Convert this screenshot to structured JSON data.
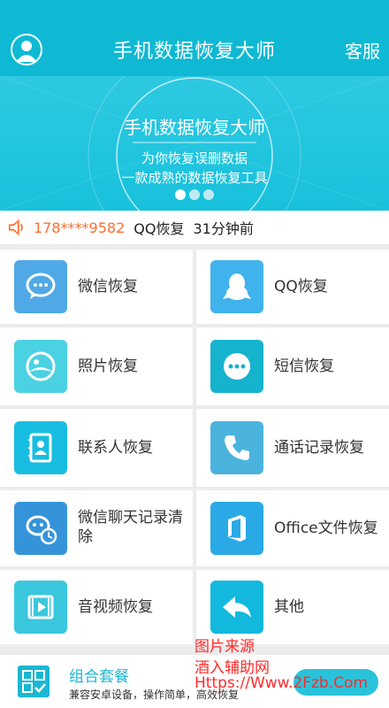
{
  "header": {
    "title": "手机数据恢复大师",
    "service": "客服"
  },
  "banner": {
    "title": "手机数据恢复大师",
    "line1": "为你恢复误删数据",
    "line2": "一款成熟的数据恢复工具"
  },
  "notice": {
    "phone": "178****9582",
    "service": "QQ恢复",
    "time": "31分钟前"
  },
  "grid": [
    {
      "label": "微信恢复",
      "icon": "wechat-icon",
      "color": "#4fa9e6"
    },
    {
      "label": "QQ恢复",
      "icon": "qq-penguin-icon",
      "color": "#40b3ec"
    },
    {
      "label": "照片恢复",
      "icon": "photo-icon",
      "color": "#4ad2e3"
    },
    {
      "label": "短信恢复",
      "icon": "sms-icon",
      "color": "#16b3ce"
    },
    {
      "label": "联系人恢复",
      "icon": "contacts-icon",
      "color": "#17bde0"
    },
    {
      "label": "通话记录恢复",
      "icon": "phone-icon",
      "color": "#4ab3dd"
    },
    {
      "label": "微信聊天记录清除",
      "icon": "wechat-clock-icon",
      "color": "#3594d9"
    },
    {
      "label": "Office文件恢复",
      "icon": "office-icon",
      "color": "#29a9e5"
    },
    {
      "label": "音视频恢复",
      "icon": "video-icon",
      "color": "#3ac7de"
    },
    {
      "label": "其他",
      "icon": "reply-arrow-icon",
      "color": "#12b9dd"
    }
  ],
  "bottom": {
    "title": "组合套餐",
    "desc": "兼容安卓设备，操作简单，高效恢复",
    "button": ""
  },
  "watermark": {
    "line1": "图片来源",
    "line2": "酒入辅助网",
    "line3": "Https://Www.2Fzb.Com"
  }
}
